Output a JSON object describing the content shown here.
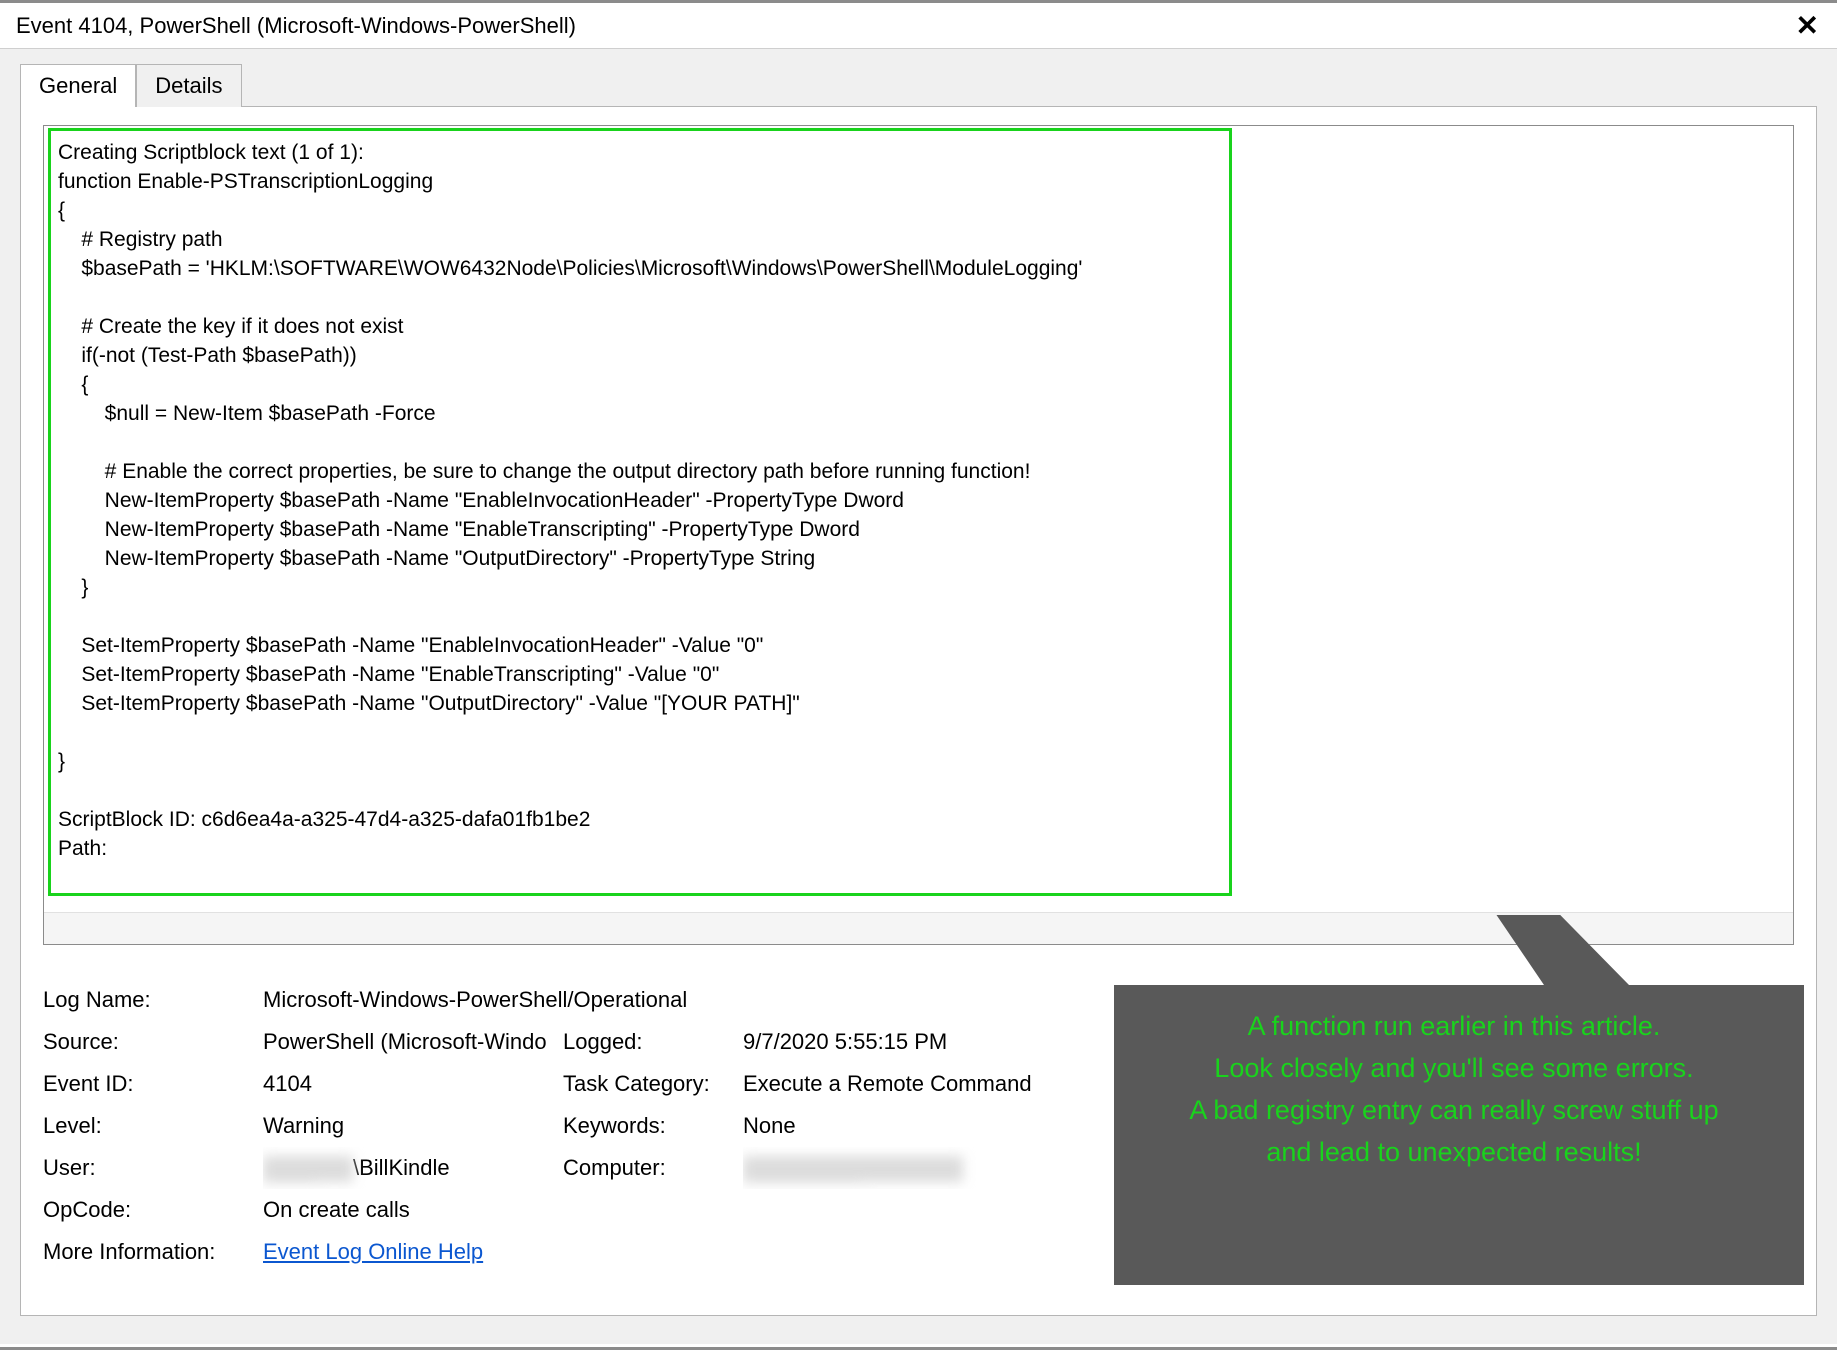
{
  "window": {
    "title": "Event 4104, PowerShell (Microsoft-Windows-PowerShell)"
  },
  "tabs": {
    "items": [
      "General",
      "Details"
    ],
    "active": 0
  },
  "script": {
    "text": "Creating Scriptblock text (1 of 1):\nfunction Enable-PSTranscriptionLogging\n{\n    # Registry path\n    $basePath = 'HKLM:\\SOFTWARE\\WOW6432Node\\Policies\\Microsoft\\Windows\\PowerShell\\ModuleLogging'\n\n    # Create the key if it does not exist\n    if(-not (Test-Path $basePath))\n    {\n        $null = New-Item $basePath -Force\n\n        # Enable the correct properties, be sure to change the output directory path before running function!\n        New-ItemProperty $basePath -Name \"EnableInvocationHeader\" -PropertyType Dword\n        New-ItemProperty $basePath -Name \"EnableTranscripting\" -PropertyType Dword\n        New-ItemProperty $basePath -Name \"OutputDirectory\" -PropertyType String\n    }\n\n    Set-ItemProperty $basePath -Name \"EnableInvocationHeader\" -Value \"0\"\n    Set-ItemProperty $basePath -Name \"EnableTranscripting\" -Value \"0\"\n    Set-ItemProperty $basePath -Name \"OutputDirectory\" -Value \"[YOUR PATH]\"\n\n}\n\nScriptBlock ID: c6d6ea4a-a325-47d4-a325-dafa01fb1be2\nPath:"
  },
  "props": {
    "labels": {
      "log_name": "Log Name:",
      "source": "Source:",
      "event_id": "Event ID:",
      "level": "Level:",
      "user": "User:",
      "opcode": "OpCode:",
      "more_info": "More Information:",
      "logged": "Logged:",
      "task_category": "Task Category:",
      "keywords": "Keywords:",
      "computer": "Computer:"
    },
    "values": {
      "log_name": "Microsoft-Windows-PowerShell/Operational",
      "source": "PowerShell (Microsoft-Windo",
      "event_id": "4104",
      "level": "Warning",
      "user_suffix": "\\BillKindle",
      "opcode": "On create calls",
      "more_info": "Event Log Online Help",
      "logged": "9/7/2020 5:55:15 PM",
      "task_category": "Execute a Remote Command",
      "keywords": "None"
    }
  },
  "callout": {
    "line1": "A function run earlier in this article.",
    "line2": "Look closely and you'll see some errors.",
    "line3": "A bad registry entry can really screw stuff up",
    "line4": "and lead to unexpected results!"
  }
}
